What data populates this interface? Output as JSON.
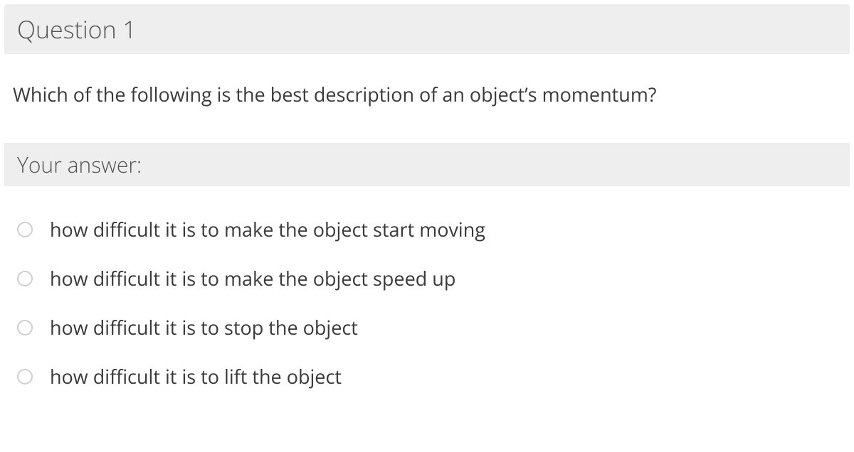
{
  "question": {
    "title": "Question 1",
    "text": "Which of the following is the best description of an object’s momentum?"
  },
  "answer": {
    "title": "Your answer:",
    "options": [
      "how difficult it is to make the object start moving",
      "how difficult it is to make the object speed up",
      "how difficult it is to stop the object",
      "how difficult it is to lift the object"
    ]
  }
}
